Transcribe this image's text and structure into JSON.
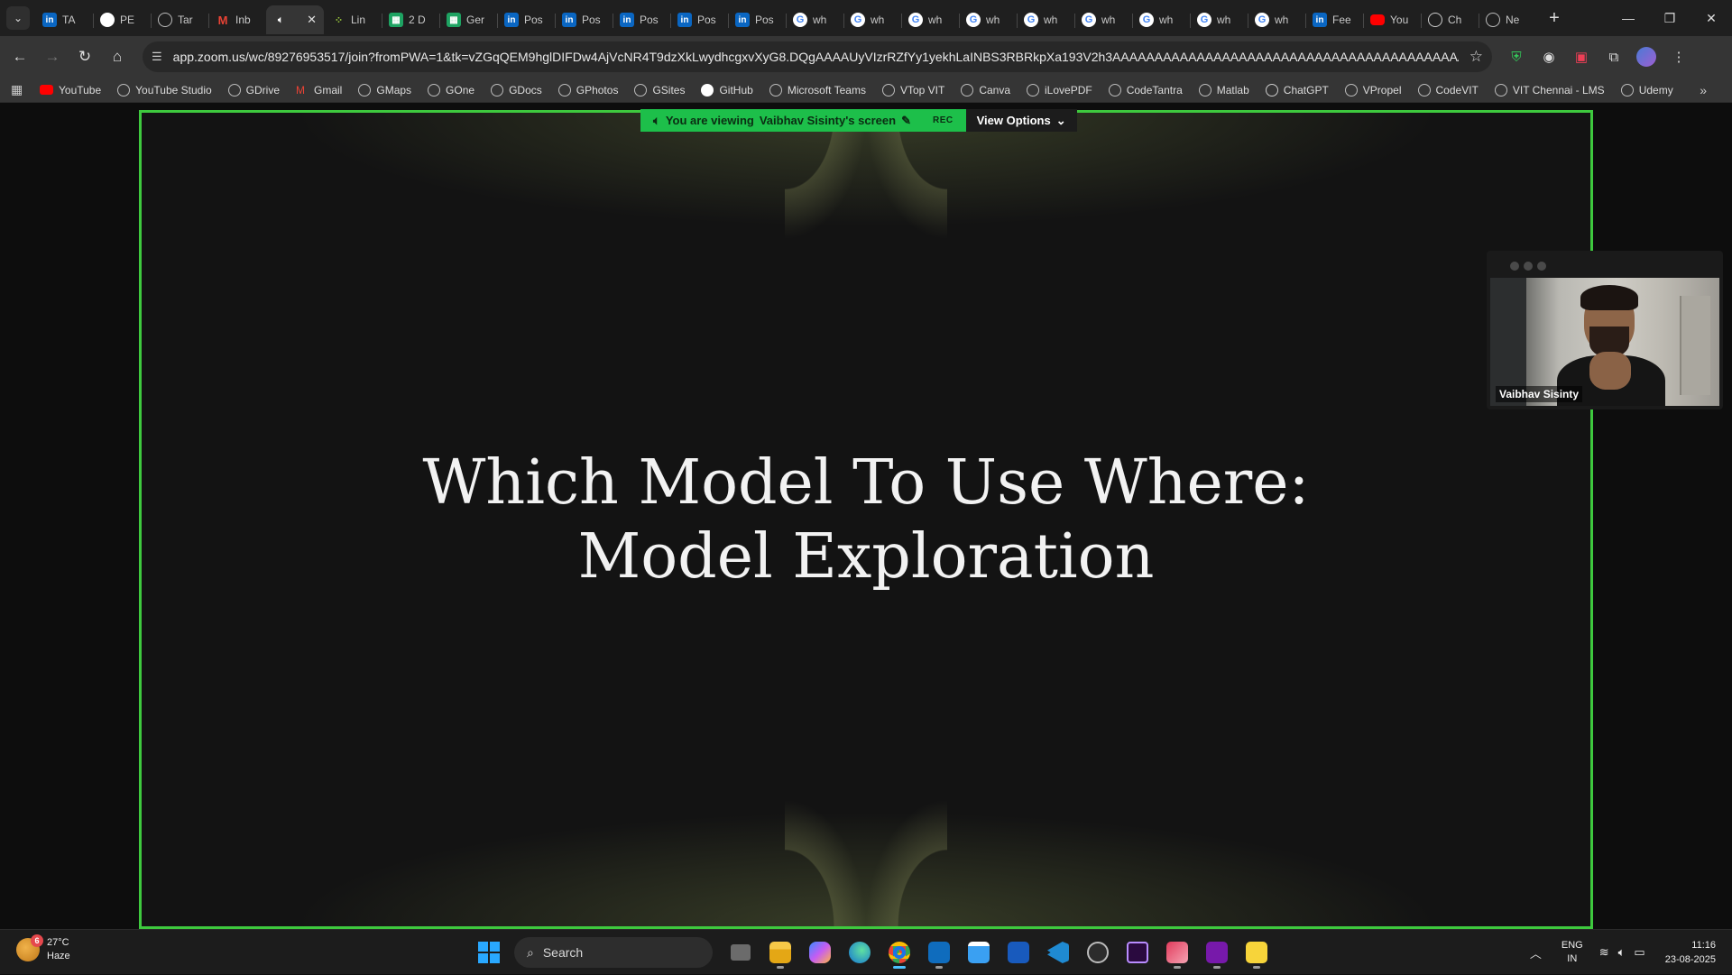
{
  "browser": {
    "tabs": [
      {
        "favicon": "linkedin-icon",
        "label": "TA"
      },
      {
        "favicon": "github-icon",
        "label": "PE"
      },
      {
        "favicon": "globe-icon",
        "label": "Tar"
      },
      {
        "favicon": "gmail-icon",
        "label": "Inb"
      },
      {
        "favicon": "speaker-icon",
        "label": "",
        "active": true
      },
      {
        "favicon": "dots-icon",
        "label": "Lin"
      },
      {
        "favicon": "sheets-icon",
        "label": "2 D"
      },
      {
        "favicon": "sheets-icon",
        "label": "Ger"
      },
      {
        "favicon": "linkedin-icon",
        "label": "Pos"
      },
      {
        "favicon": "linkedin-icon",
        "label": "Pos"
      },
      {
        "favicon": "linkedin-icon",
        "label": "Pos"
      },
      {
        "favicon": "linkedin-icon",
        "label": "Pos"
      },
      {
        "favicon": "linkedin-icon",
        "label": "Pos"
      },
      {
        "favicon": "google-icon",
        "label": "wh"
      },
      {
        "favicon": "google-icon",
        "label": "wh"
      },
      {
        "favicon": "google-icon",
        "label": "wh"
      },
      {
        "favicon": "google-icon",
        "label": "wh"
      },
      {
        "favicon": "google-icon",
        "label": "wh"
      },
      {
        "favicon": "google-icon",
        "label": "wh"
      },
      {
        "favicon": "google-icon",
        "label": "wh"
      },
      {
        "favicon": "google-icon",
        "label": "wh"
      },
      {
        "favicon": "google-icon",
        "label": "wh"
      },
      {
        "favicon": "linkedin-icon",
        "label": "Fee"
      },
      {
        "favicon": "youtube-icon",
        "label": "You"
      },
      {
        "favicon": "chatgpt-icon",
        "label": "Ch"
      },
      {
        "favicon": "globe-icon",
        "label": "Ne"
      }
    ],
    "url": "app.zoom.us/wc/89276953517/join?fromPWA=1&tk=vZGqQEM9hglDIFDw4AjVcNR4T9dzXkLwydhcgxvXyG8.DQgAAAAUyVIzrRZfYy1yekhLaINBS3RBRkpXa193V2h3AAAAAAAAAAAAAAAAAAAAAAAAAAAAAAAAAAAAAAAAAAAAA&_x_zm_r...",
    "bookmarks": [
      {
        "icon": "youtube",
        "label": "YouTube"
      },
      {
        "icon": "globe",
        "label": "YouTube Studio"
      },
      {
        "icon": "globe",
        "label": "GDrive"
      },
      {
        "icon": "gmail",
        "label": "Gmail"
      },
      {
        "icon": "globe",
        "label": "GMaps"
      },
      {
        "icon": "globe",
        "label": "GOne"
      },
      {
        "icon": "globe",
        "label": "GDocs"
      },
      {
        "icon": "globe",
        "label": "GPhotos"
      },
      {
        "icon": "globe",
        "label": "GSites"
      },
      {
        "icon": "github",
        "label": "GitHub"
      },
      {
        "icon": "globe",
        "label": "Microsoft Teams"
      },
      {
        "icon": "globe",
        "label": "VTop VIT"
      },
      {
        "icon": "globe",
        "label": "Canva"
      },
      {
        "icon": "globe",
        "label": "iLovePDF"
      },
      {
        "icon": "globe",
        "label": "CodeTantra"
      },
      {
        "icon": "globe",
        "label": "Matlab"
      },
      {
        "icon": "chatgpt",
        "label": "ChatGPT"
      },
      {
        "icon": "globe",
        "label": "VPropel"
      },
      {
        "icon": "globe",
        "label": "CodeVIT"
      },
      {
        "icon": "globe",
        "label": "VIT Chennai - LMS"
      },
      {
        "icon": "globe",
        "label": "Udemy"
      }
    ]
  },
  "meeting": {
    "viewing_prefix": "You are viewing",
    "viewing_name": "Vaibhav Sisinty's screen",
    "rec_label": "REC",
    "view_options_label": "View Options",
    "slide_title_line1": "Which Model To Use Where:",
    "slide_title_line2": "Model Exploration",
    "participant_name": "Vaibhav Sisinty",
    "accent_color": "#3ec93e"
  },
  "taskbar": {
    "weather_temp": "27°C",
    "weather_desc": "Haze",
    "weather_badge": "6",
    "search_label": "Search",
    "apps": [
      "task-view",
      "file-explorer",
      "copilot",
      "edge",
      "chrome",
      "outlook",
      "store",
      "word",
      "vscode",
      "obs",
      "premiere-pro",
      "snipping-tool",
      "onenote",
      "sticky-notes"
    ],
    "lang_line1": "ENG",
    "lang_line2": "IN",
    "time": "11:16",
    "date": "23-08-2025"
  }
}
